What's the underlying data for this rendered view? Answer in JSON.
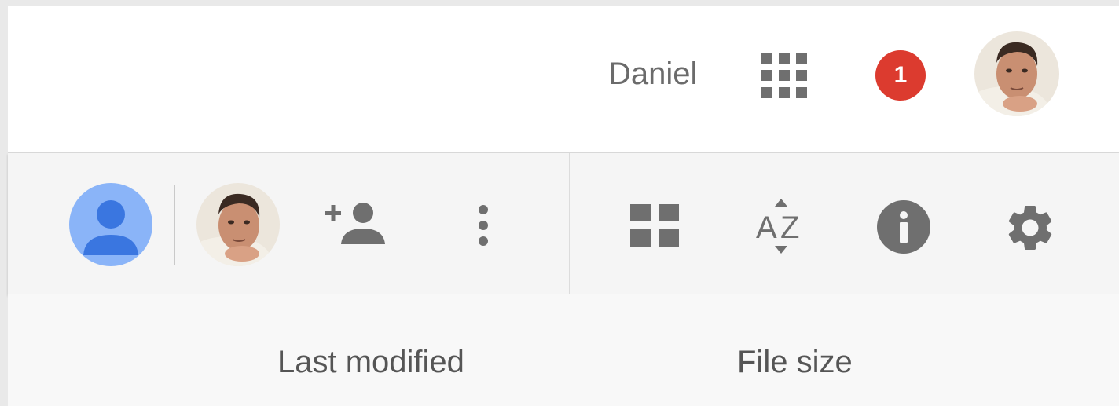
{
  "header": {
    "username": "Daniel",
    "notification_count": "1",
    "icons": {
      "apps": "apps-grid-icon",
      "account_avatar": "user-photo-avatar"
    }
  },
  "toolbar": {
    "icons": {
      "me": "person-icon",
      "shared_user": "user-photo-avatar",
      "add_person": "person-add-icon",
      "more": "more-vert-icon",
      "view": "grid-view-icon",
      "sort": "sort-az-icon",
      "info": "info-icon",
      "settings": "gear-icon"
    }
  },
  "columns": {
    "last_modified": "Last modified",
    "file_size": "File size"
  },
  "colors": {
    "notification_badge": "#dc3b2f",
    "person_circle": "#8ab4f8",
    "person_icon": "#3a76e0",
    "icon_gray": "#6f6f6f"
  }
}
